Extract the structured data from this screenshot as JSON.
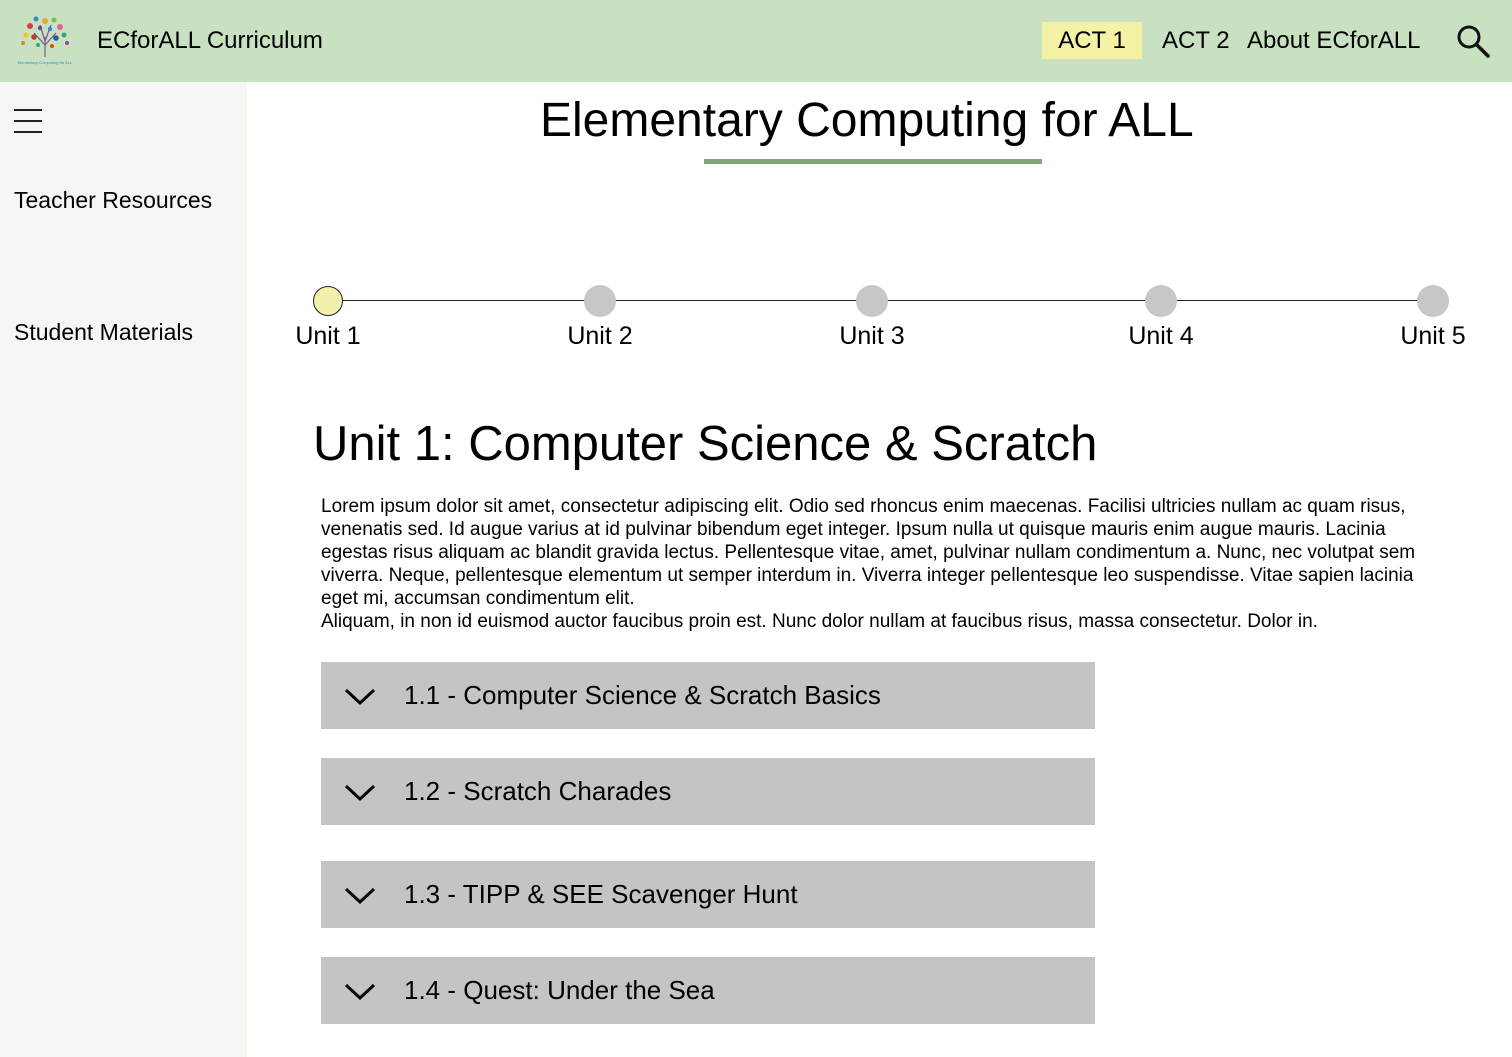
{
  "header": {
    "title": "ECforALL Curriculum",
    "logo_icon": "tree-logo-icon",
    "logo_caption": "Elementary Computing for ALL",
    "nav": [
      {
        "label": "ACT 1",
        "active": true
      },
      {
        "label": "ACT 2",
        "active": false
      },
      {
        "label": "About ECforALL",
        "active": false
      }
    ],
    "search_icon": "search-icon",
    "background_color": "#c8e2c1",
    "active_nav_color": "#f5f1a5"
  },
  "sidebar": {
    "menu_icon": "hamburger-menu-icon",
    "items": [
      {
        "label": "Teacher Resources"
      },
      {
        "label": "Student Materials"
      }
    ]
  },
  "main": {
    "title": "Elementary Computing for ALL",
    "accent_color": "#7fa876",
    "units": [
      {
        "label": "Unit 1",
        "active": true
      },
      {
        "label": "Unit 2",
        "active": false
      },
      {
        "label": "Unit 3",
        "active": false
      },
      {
        "label": "Unit 4",
        "active": false
      },
      {
        "label": "Unit 5",
        "active": false
      }
    ],
    "unit_heading": "Unit 1: Computer Science & Scratch",
    "unit_description": [
      "Lorem ipsum dolor sit amet, consectetur adipiscing elit. Odio sed rhoncus enim maecenas. Facilisi ultricies nullam ac quam risus, venenatis sed. Id augue varius at id pulvinar bibendum eget integer. Ipsum nulla ut quisque mauris enim augue mauris. Lacinia egestas risus aliquam ac blandit gravida lectus. Pellentesque vitae, amet, pulvinar nullam condimentum a. Nunc, nec volutpat sem viverra. Neque, pellentesque elementum ut semper interdum in. Viverra integer pellentesque leo suspendisse. Vitae sapien lacinia eget mi, accumsan condimentum elit.",
      "Aliquam, in non id euismod auctor faucibus proin est. Nunc dolor nullam at faucibus risus, massa consectetur. Dolor in."
    ],
    "lessons": [
      {
        "label": "1.1 - Computer Science & Scratch Basics",
        "icon": "chevron-down-icon"
      },
      {
        "label": "1.2 - Scratch Charades",
        "icon": "chevron-down-icon"
      },
      {
        "label": "1.3 - TIPP & SEE Scavenger Hunt",
        "icon": "chevron-down-icon"
      },
      {
        "label": "1.4 - Quest: Under the Sea",
        "icon": "chevron-down-icon"
      }
    ]
  }
}
